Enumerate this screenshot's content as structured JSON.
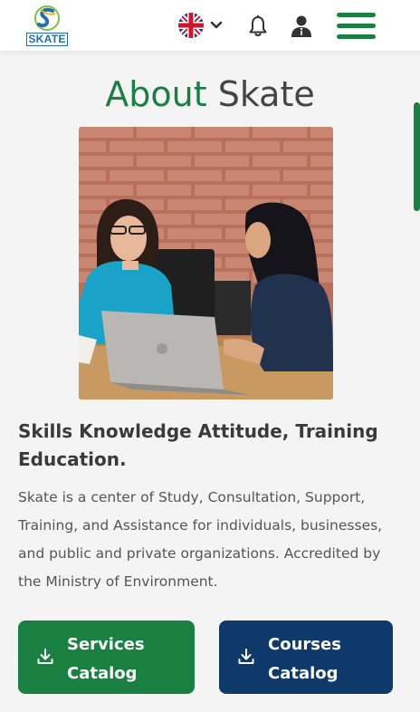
{
  "header": {
    "logo_text": "SKATE",
    "icons": {
      "logo": "skate-logo",
      "language": "uk-flag-icon",
      "language_dropdown": "chevron-down-icon",
      "notifications": "bell-icon",
      "account": "user-icon",
      "menu": "hamburger-menu-icon"
    }
  },
  "about": {
    "title_first": "About",
    "title_second": "Skate",
    "image": "two-women-working-at-laptop-photo",
    "subtitle": "Skills Knowledge Attitude, Training Education.",
    "description": "Skate is a center of Study, Consultation, Support, Training, and Assistance for individuals, businesses, and public and private organizations. Accredited by the Ministry of Environment."
  },
  "buttons": [
    {
      "label": "Services Catalog",
      "icon": "download-icon"
    },
    {
      "label": "Courses Catalog",
      "icon": "download-icon"
    }
  ],
  "colors": {
    "brand_green": "#1a8042",
    "brand_navy": "#0d3a6a",
    "heading_gray": "#444444",
    "background": "#f4f4f4"
  }
}
